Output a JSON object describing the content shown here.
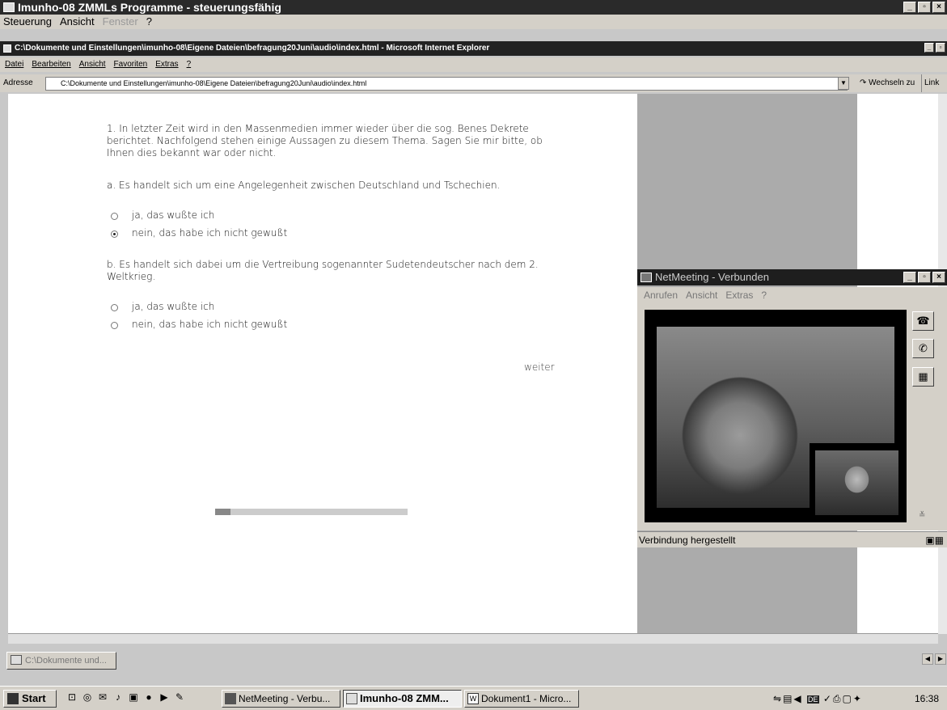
{
  "app_window": {
    "title": "Imunho-08 ZMMLs Programme - steuerungsfähig",
    "menu": [
      "Steuerung",
      "Ansicht",
      "Fenster",
      "?"
    ],
    "menu_disabled_index": 2
  },
  "ie_window": {
    "title": "C:\\Dokumente und Einstellungen\\imunho-08\\Eigene Dateien\\befragung20Juni\\audio\\index.html - Microsoft Internet Explorer",
    "menu": [
      "Datei",
      "Bearbeiten",
      "Ansicht",
      "Favoriten",
      "Extras",
      "?"
    ],
    "address_label": "Adresse",
    "address_value": "C:\\Dokumente und Einstellungen\\imunho-08\\Eigene Dateien\\befragung20Juni\\audio\\index.html",
    "go_label": "Wechseln zu",
    "links_label": "Link"
  },
  "survey": {
    "question": "1. In letzter Zeit wird in den Massenmedien immer wieder über die sog. Benes Dekrete berichtet. Nachfolgend stehen einige Aussagen zu diesem Thema. Sagen Sie mir bitte, ob Ihnen dies bekannt war oder nicht.",
    "item_a": "a. Es handelt sich um eine Angelegenheit zwischen Deutschland und Tschechien.",
    "item_a_options": [
      {
        "label": "ja, das wußte ich",
        "checked": false
      },
      {
        "label": "nein, das habe ich nicht gewußt",
        "checked": true
      }
    ],
    "item_b": "b. Es handelt sich dabei um die Vertreibung sogenannter Sudetendeutscher nach dem 2. Weltkrieg.",
    "item_b_options": [
      {
        "label": "ja, das wußte ich",
        "checked": false
      },
      {
        "label": "nein, das habe ich nicht gewußt",
        "checked": false
      }
    ],
    "next_label": "weiter",
    "progress_fraction": 0.08
  },
  "netmeeting": {
    "title": "NetMeeting - Verbunden",
    "menu": [
      "Anrufen",
      "Ansicht",
      "Extras",
      "?"
    ],
    "status": "Verbindung hergestellt",
    "side_buttons": [
      "phone-icon",
      "hangup-icon",
      "directory-icon"
    ]
  },
  "lower_task": {
    "label": "C:\\Dokumente und..."
  },
  "taskbar": {
    "start_label": "Start",
    "buttons": [
      {
        "label": "NetMeeting - Verbu...",
        "active": false
      },
      {
        "label": "Imunho-08 ZMM...",
        "active": true
      },
      {
        "label": "Dokument1 - Micro...",
        "active": false
      }
    ],
    "tray_lang": "DE",
    "clock": "16:38"
  }
}
